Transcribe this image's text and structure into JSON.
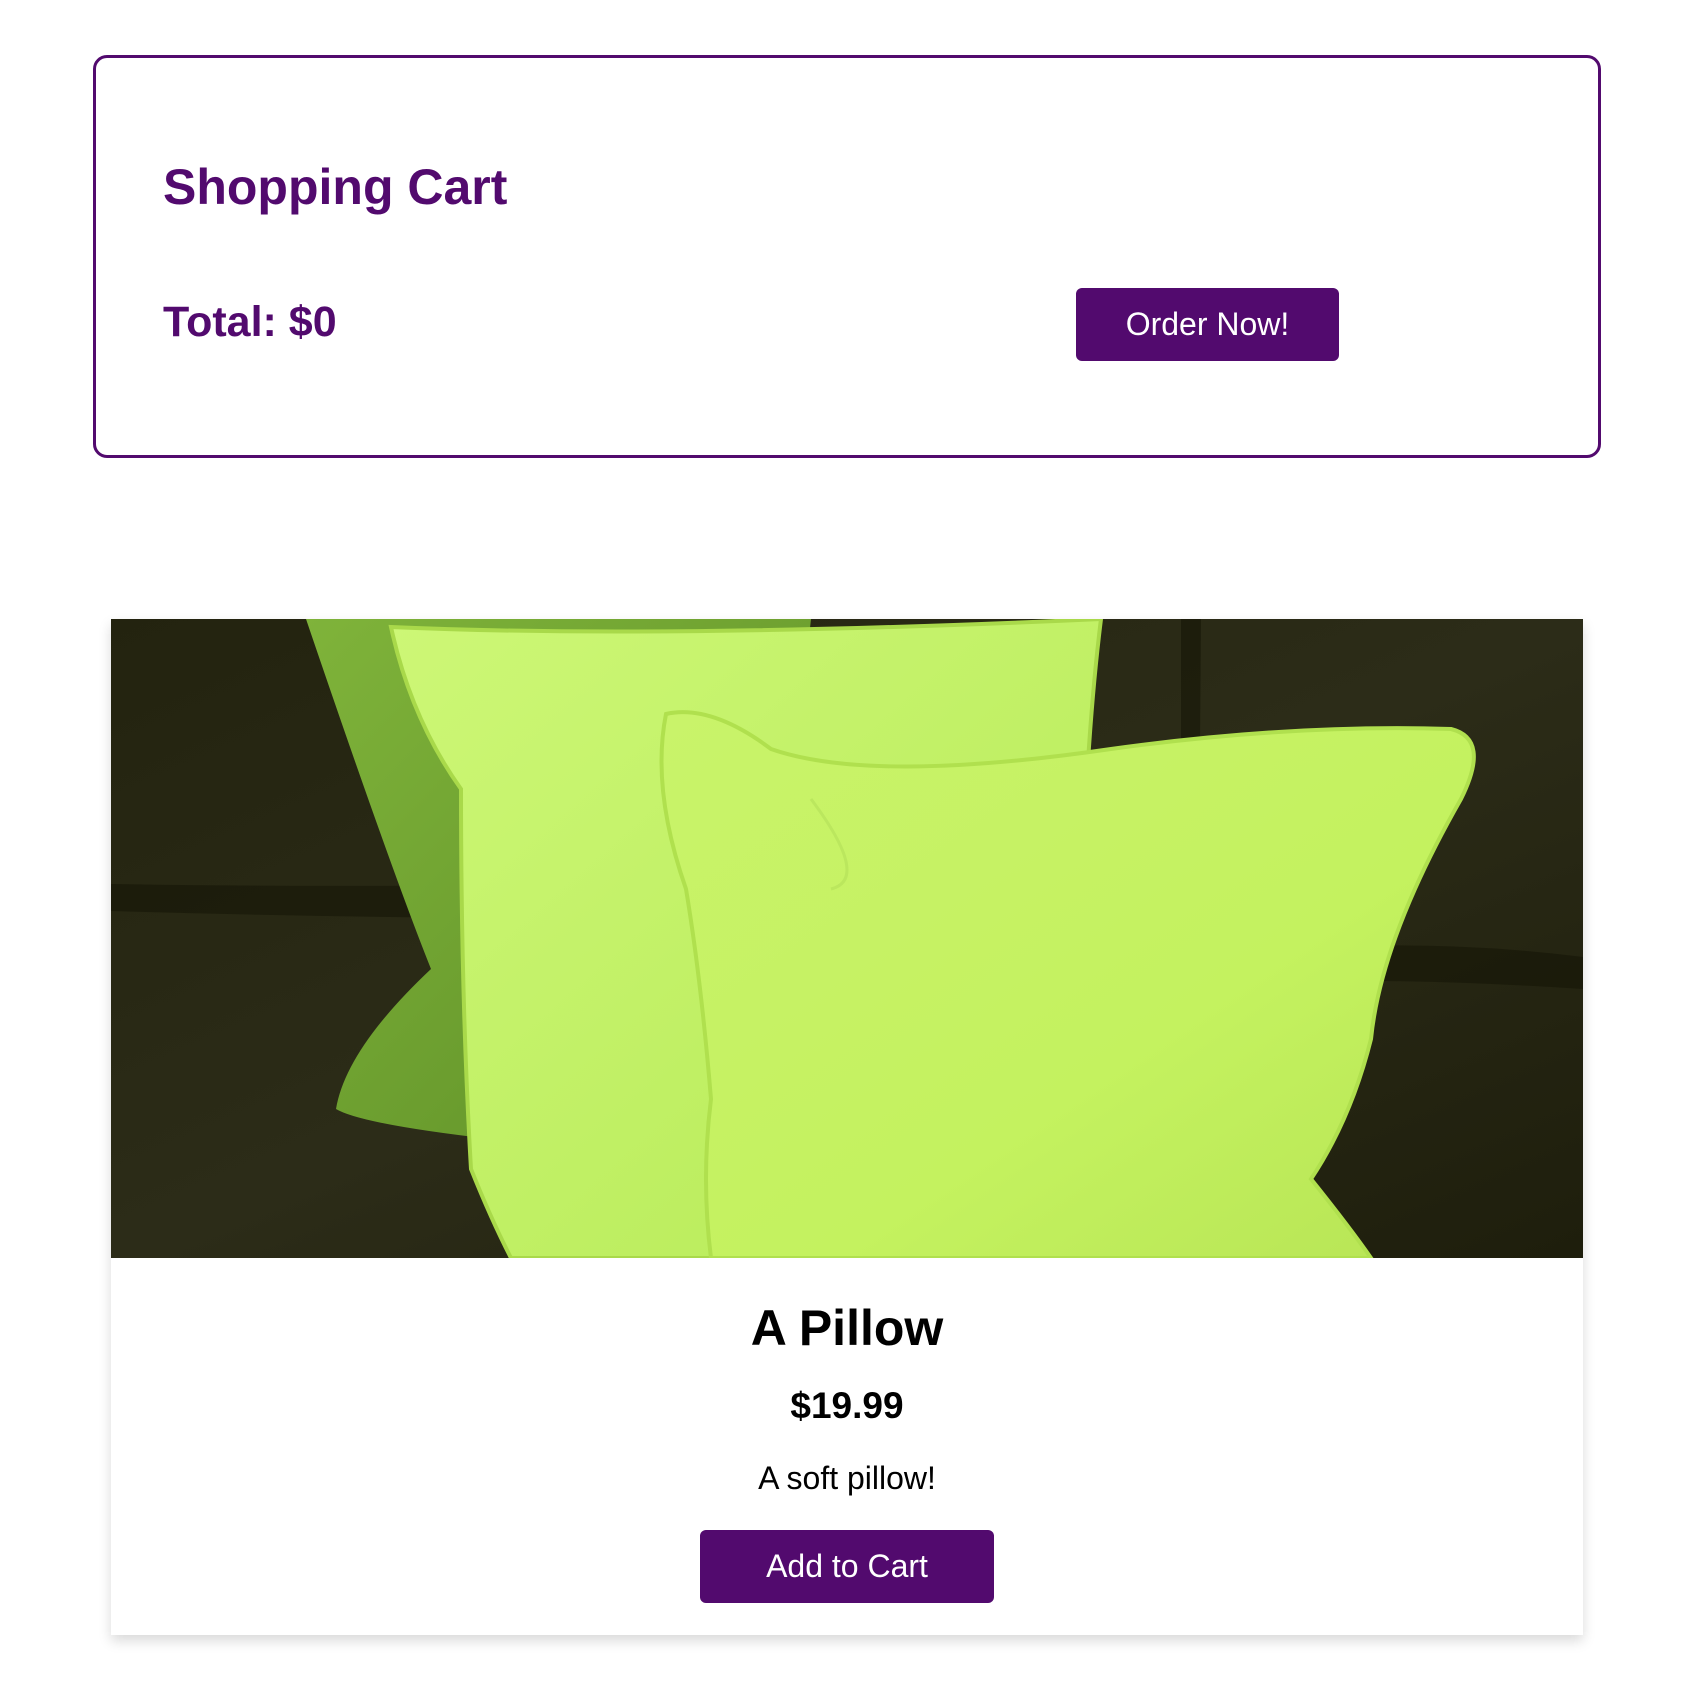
{
  "cart": {
    "title": "Shopping Cart",
    "total_label": "Total: $0",
    "order_button_label": "Order Now!"
  },
  "product": {
    "name": "A Pillow",
    "price": "$19.99",
    "description": "A soft pillow!",
    "add_button_label": "Add to Cart",
    "image_icon": "pillow-photo"
  },
  "colors": {
    "accent": "#520a6e",
    "pillow_green": "#c4f25f",
    "sofa_dark": "#2a2a16"
  }
}
